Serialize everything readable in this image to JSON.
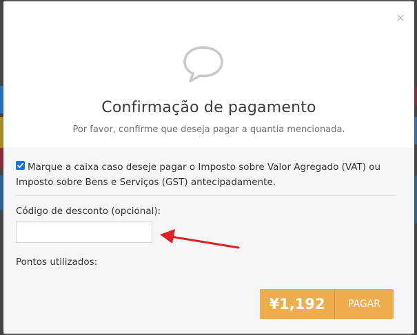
{
  "dialog": {
    "title": "Confirmação de pagamento",
    "subtitle": "Por favor, confirme que deseja pagar a quantia mencionada.",
    "close_glyph": "×",
    "icon": "speech-bubble-icon"
  },
  "vat": {
    "checked": true,
    "label": "Marque a caixa caso deseje pagar o Imposto sobre Valor Agregado (VAT) ou Imposto sobre Bens e Serviços (GST) antecipadamente."
  },
  "discount": {
    "label": "Código de desconto (opcional):",
    "value": "",
    "placeholder": ""
  },
  "points": {
    "label": "Pontos utilizados:"
  },
  "pay_button": {
    "amount": "¥1,192",
    "label": "PAGAR"
  },
  "colors": {
    "pay_button": "#f0ad4e",
    "annotation_arrow": "#e02020",
    "checkbox": "#1a73e8"
  }
}
